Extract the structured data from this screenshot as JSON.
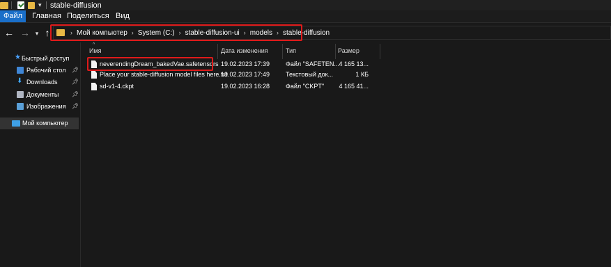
{
  "window": {
    "title": "stable-diffusion"
  },
  "ribbon": {
    "tabs": [
      {
        "label": "Файл"
      },
      {
        "label": "Главная"
      },
      {
        "label": "Поделиться"
      },
      {
        "label": "Вид"
      }
    ]
  },
  "address": {
    "crumbs": [
      "Мой компьютер",
      "System (C:)",
      "stable-diffusion-ui",
      "models",
      "stable-diffusion"
    ]
  },
  "sidebar": {
    "items": [
      {
        "label": "Быстрый доступ",
        "icon": "star-icon"
      },
      {
        "label": "Рабочий стол",
        "icon": "desktop-icon"
      },
      {
        "label": "Downloads",
        "icon": "download-icon"
      },
      {
        "label": "Документы",
        "icon": "documents-icon"
      },
      {
        "label": "Изображения",
        "icon": "pictures-icon"
      },
      {
        "label": "Мой компьютер",
        "icon": "computer-icon",
        "selected": true
      }
    ]
  },
  "columns": {
    "name": "Имя",
    "date": "Дата изменения",
    "type": "Тип",
    "size": "Размер"
  },
  "files": [
    {
      "name": "neverendingDream_bakedVae.safetensors",
      "date": "19.02.2023 17:39",
      "type": "Файл \"SAFETEN...",
      "size": "4 165 13..."
    },
    {
      "name": "Place your stable-diffusion model files here.txt",
      "date": "19.02.2023 17:49",
      "type": "Текстовый док...",
      "size": "1 КБ"
    },
    {
      "name": "sd-v1-4.ckpt",
      "date": "19.02.2023 16:28",
      "type": "Файл \"CKPT\"",
      "size": "4 165 41..."
    }
  ],
  "colors": {
    "accent": "#1a6fc9",
    "highlight": "#e01a1a",
    "folder": "#e8b844",
    "background": "#191919"
  }
}
